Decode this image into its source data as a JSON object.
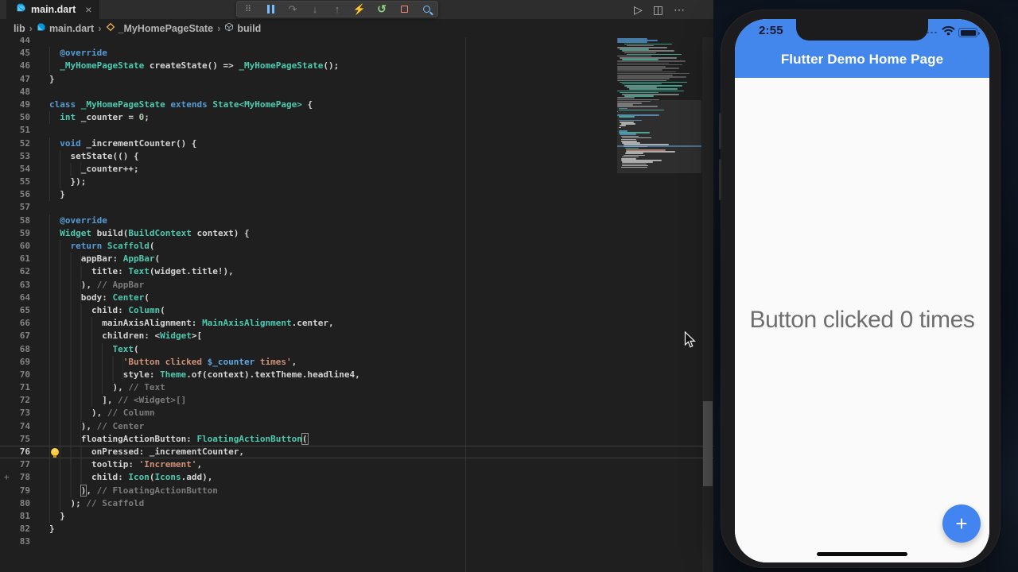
{
  "window": {
    "tab_label": "main.dart"
  },
  "icons": {
    "close": "×",
    "grip": "⠿",
    "step_over": "↷",
    "step_into": "↓",
    "step_out": "↑",
    "hot_reload": "⚡",
    "restart": "↺",
    "run": "▷",
    "split": "◫",
    "more": "⋯",
    "chevron": "›"
  },
  "breadcrumbs": {
    "items": [
      {
        "label": "lib"
      },
      {
        "label": "main.dart"
      },
      {
        "label": "_MyHomePageState"
      },
      {
        "label": "build"
      }
    ]
  },
  "editor": {
    "lines": [
      {
        "n": 44,
        "ind": 0,
        "toks": []
      },
      {
        "n": 45,
        "ind": 2,
        "toks": [
          [
            "k",
            "@override"
          ]
        ]
      },
      {
        "n": 46,
        "ind": 2,
        "toks": [
          [
            "t",
            "_MyHomePageState"
          ],
          [
            "p",
            " createState() => "
          ],
          [
            "t",
            "_MyHomePageState"
          ],
          [
            "p",
            "();"
          ]
        ]
      },
      {
        "n": 47,
        "ind": 0,
        "toks": [
          [
            "p",
            "}"
          ]
        ]
      },
      {
        "n": 48,
        "ind": 0,
        "toks": []
      },
      {
        "n": 49,
        "ind": 0,
        "toks": [
          [
            "k",
            "class"
          ],
          [
            "p",
            " "
          ],
          [
            "t",
            "_MyHomePageState"
          ],
          [
            "p",
            " "
          ],
          [
            "k",
            "extends"
          ],
          [
            "p",
            " "
          ],
          [
            "t",
            "State<MyHomePage>"
          ],
          [
            "p",
            " {"
          ]
        ]
      },
      {
        "n": 50,
        "ind": 2,
        "toks": [
          [
            "t",
            "int"
          ],
          [
            "p",
            " _counter = "
          ],
          [
            "num",
            "0"
          ],
          [
            "p",
            ";"
          ]
        ]
      },
      {
        "n": 51,
        "ind": 0,
        "toks": []
      },
      {
        "n": 52,
        "ind": 2,
        "toks": [
          [
            "k",
            "void"
          ],
          [
            "p",
            " _incrementCounter() {"
          ]
        ]
      },
      {
        "n": 53,
        "ind": 4,
        "toks": [
          [
            "p",
            "setState(() {"
          ]
        ]
      },
      {
        "n": 54,
        "ind": 6,
        "toks": [
          [
            "p",
            "_counter++;"
          ]
        ]
      },
      {
        "n": 55,
        "ind": 4,
        "toks": [
          [
            "p",
            "});"
          ]
        ]
      },
      {
        "n": 56,
        "ind": 2,
        "toks": [
          [
            "p",
            "}"
          ]
        ]
      },
      {
        "n": 57,
        "ind": 0,
        "toks": []
      },
      {
        "n": 58,
        "ind": 2,
        "toks": [
          [
            "k",
            "@override"
          ]
        ]
      },
      {
        "n": 59,
        "ind": 2,
        "toks": [
          [
            "t",
            "Widget"
          ],
          [
            "p",
            " build("
          ],
          [
            "t",
            "BuildContext"
          ],
          [
            "p",
            " context) {"
          ]
        ]
      },
      {
        "n": 60,
        "ind": 4,
        "toks": [
          [
            "k",
            "return"
          ],
          [
            "p",
            " "
          ],
          [
            "t",
            "Scaffold"
          ],
          [
            "p",
            "("
          ]
        ]
      },
      {
        "n": 61,
        "ind": 6,
        "toks": [
          [
            "p",
            "appBar: "
          ],
          [
            "t",
            "AppBar"
          ],
          [
            "p",
            "("
          ]
        ]
      },
      {
        "n": 62,
        "ind": 8,
        "toks": [
          [
            "p",
            "title: "
          ],
          [
            "t",
            "Text"
          ],
          [
            "p",
            "(widget.title!),"
          ]
        ]
      },
      {
        "n": 63,
        "ind": 6,
        "toks": [
          [
            "p",
            "), "
          ],
          [
            "c",
            "// AppBar"
          ]
        ]
      },
      {
        "n": 64,
        "ind": 6,
        "toks": [
          [
            "p",
            "body: "
          ],
          [
            "t",
            "Center"
          ],
          [
            "p",
            "("
          ]
        ]
      },
      {
        "n": 65,
        "ind": 8,
        "toks": [
          [
            "p",
            "child: "
          ],
          [
            "t",
            "Column"
          ],
          [
            "p",
            "("
          ]
        ]
      },
      {
        "n": 66,
        "ind": 10,
        "toks": [
          [
            "p",
            "mainAxisAlignment: "
          ],
          [
            "t",
            "MainAxisAlignment"
          ],
          [
            "p",
            ".center,"
          ]
        ]
      },
      {
        "n": 67,
        "ind": 10,
        "toks": [
          [
            "p",
            "children: <"
          ],
          [
            "t",
            "Widget"
          ],
          [
            "p",
            ">["
          ]
        ]
      },
      {
        "n": 68,
        "ind": 12,
        "toks": [
          [
            "t",
            "Text"
          ],
          [
            "p",
            "("
          ]
        ]
      },
      {
        "n": 69,
        "ind": 14,
        "toks": [
          [
            "s",
            "'Button clicked "
          ],
          [
            "v",
            "$_counter"
          ],
          [
            "s",
            " times'"
          ],
          [
            "p",
            ","
          ]
        ]
      },
      {
        "n": 70,
        "ind": 14,
        "toks": [
          [
            "p",
            "style: "
          ],
          [
            "t",
            "Theme"
          ],
          [
            "p",
            ".of(context).textTheme.headline4,"
          ]
        ]
      },
      {
        "n": 71,
        "ind": 12,
        "toks": [
          [
            "p",
            "), "
          ],
          [
            "c",
            "// Text"
          ]
        ]
      },
      {
        "n": 72,
        "ind": 10,
        "toks": [
          [
            "p",
            "], "
          ],
          [
            "c",
            "// <Widget>[]"
          ]
        ]
      },
      {
        "n": 73,
        "ind": 8,
        "toks": [
          [
            "p",
            "), "
          ],
          [
            "c",
            "// Column"
          ]
        ]
      },
      {
        "n": 74,
        "ind": 6,
        "toks": [
          [
            "p",
            "), "
          ],
          [
            "c",
            "// Center"
          ]
        ]
      },
      {
        "n": 75,
        "ind": 6,
        "toks": [
          [
            "p",
            "floatingActionButton: "
          ],
          [
            "t",
            "FloatingActionButton"
          ],
          [
            "bm",
            "("
          ]
        ]
      },
      {
        "n": 76,
        "ind": 8,
        "toks": [
          [
            "p",
            "onPressed: _incrementCounter,"
          ]
        ],
        "cur": true,
        "bulb": true
      },
      {
        "n": 77,
        "ind": 8,
        "toks": [
          [
            "p",
            "tooltip: "
          ],
          [
            "s",
            "'Increment'"
          ],
          [
            "p",
            ","
          ]
        ]
      },
      {
        "n": 78,
        "ind": 8,
        "toks": [
          [
            "p",
            "child: "
          ],
          [
            "t",
            "Icon"
          ],
          [
            "p",
            "("
          ],
          [
            "t",
            "Icons"
          ],
          [
            "p",
            ".add),"
          ]
        ],
        "plus": true
      },
      {
        "n": 79,
        "ind": 6,
        "toks": [
          [
            "bm",
            ")"
          ],
          [
            "p",
            ", "
          ],
          [
            "c",
            "// FloatingActionButton"
          ]
        ]
      },
      {
        "n": 80,
        "ind": 4,
        "toks": [
          [
            "p",
            "); "
          ],
          [
            "c",
            "// Scaffold"
          ]
        ]
      },
      {
        "n": 81,
        "ind": 2,
        "toks": [
          [
            "p",
            "}"
          ]
        ]
      },
      {
        "n": 82,
        "ind": 0,
        "toks": [
          [
            "p",
            "}"
          ]
        ]
      },
      {
        "n": 83,
        "ind": 0,
        "toks": []
      }
    ]
  },
  "phone": {
    "status_time": "2:55",
    "appbar_title": "Flutter Demo Home Page",
    "counter_text": "Button clicked 0 times",
    "fab_glyph": "+"
  },
  "colors": {
    "appbar_blue": "#4387EC",
    "fab_blue": "#4285F0",
    "editor_bg": "#1f1f1f",
    "keyword_blue": "#569CD6",
    "type_teal": "#4EC9B0",
    "string_orange": "#CE9178",
    "comment_gray": "#7b7b7b",
    "lightbulb_yellow": "#FFC531"
  }
}
